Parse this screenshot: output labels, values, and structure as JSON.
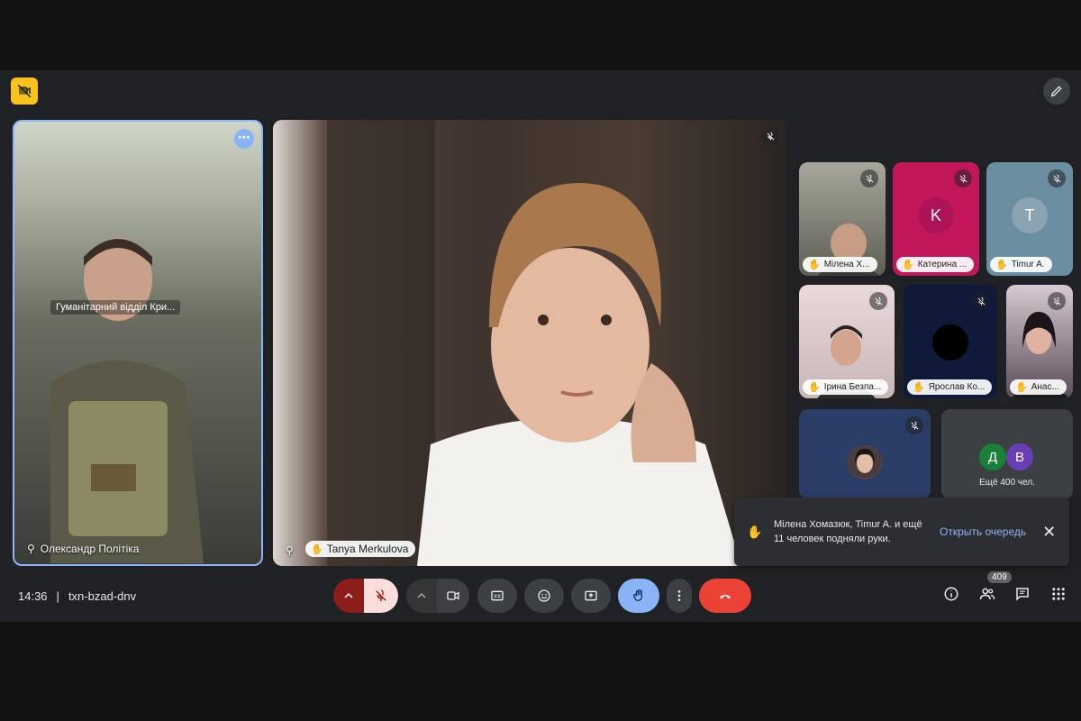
{
  "meeting": {
    "time": "14:36",
    "separator": "|",
    "code": "txn-bzad-dnv",
    "participant_count": "409"
  },
  "left_tile": {
    "overlay_caption": "Гуманітарний відділ Кри...",
    "name": "Олександр Політіка"
  },
  "main_tile": {
    "name": "Tanya Merkulova"
  },
  "grid": [
    {
      "name": "Мілена Х...",
      "type": "video"
    },
    {
      "name": "Катерина ...",
      "type": "letter",
      "letter": "K",
      "bg": "#c2185b",
      "avatar_bg": "#ad1457"
    },
    {
      "name": "Timur A.",
      "type": "letter",
      "letter": "T",
      "bg": "#6c8ea1",
      "avatar_bg": "#8aa4b4"
    },
    {
      "name": "Ірина Безпа...",
      "type": "video"
    },
    {
      "name": "Ярослав Ко...",
      "type": "dark"
    },
    {
      "name": "Анас...",
      "type": "video"
    },
    {
      "name": "",
      "type": "video-small"
    }
  ],
  "more_tile": {
    "letters": [
      "Д",
      "В"
    ],
    "label": "Ещё 400 чел."
  },
  "notification": {
    "text": "Мілена Хомазюк, Timur A. и ещё 11 человек подняли руки.",
    "link": "Открыть очередь"
  },
  "colors": {
    "hangup": "#ea4335",
    "raise_hand": "#8ab4f8",
    "mic_off_bg": "#f9dedc",
    "mic_menu": "#8c1d18",
    "corner_badge": "#f9c31c"
  }
}
